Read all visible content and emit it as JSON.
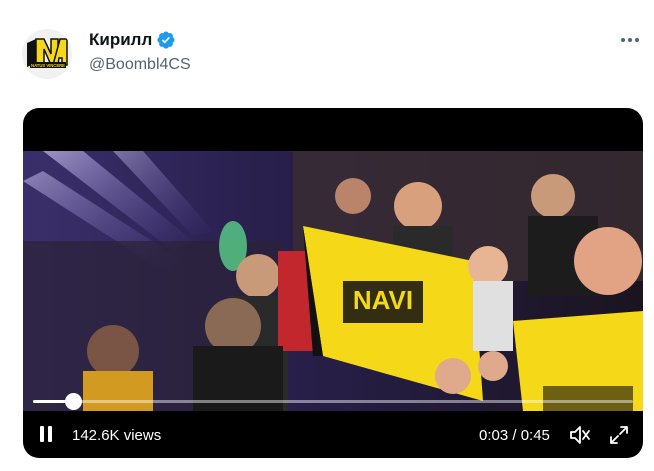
{
  "tweet": {
    "author": {
      "display_name": "Кирилл",
      "handle": "@Boombl4CS",
      "verified": true,
      "avatar_icon": "navi-logo-icon"
    },
    "more_icon": "more-horizontal-icon",
    "video": {
      "views": "142.6K views",
      "time": "0:03 / 0:45",
      "progress_fraction": 0.067,
      "controls": {
        "pause_icon": "pause-icon",
        "mute_icon": "volume-muted-icon",
        "fullscreen_icon": "fullscreen-icon"
      }
    }
  },
  "colors": {
    "text_primary": "#0f1419",
    "text_secondary": "#536471",
    "verified_blue": "#1d9bf0",
    "navi_yellow": "#f5d817",
    "navi_black": "#111111",
    "video_bg": "#000000"
  }
}
